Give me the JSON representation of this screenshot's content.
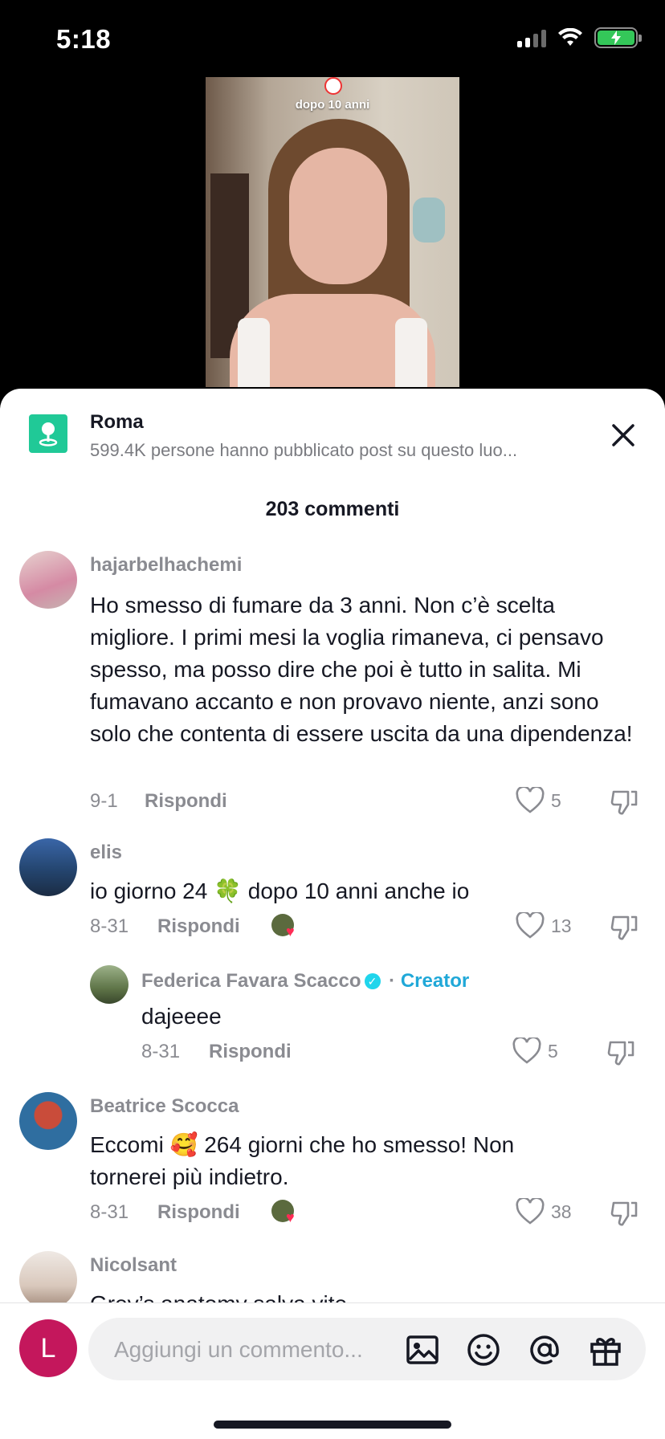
{
  "status_bar": {
    "time": "5:18"
  },
  "video": {
    "caption": "dopo 10 anni"
  },
  "location": {
    "title": "Roma",
    "subtitle": "599.4K persone hanno pubblicato post su questo luo..."
  },
  "comments_header": "203 commenti",
  "comments": [
    {
      "username": "hajarbelhachemi",
      "text": "Ho smesso di fumare da 3 anni. Non c’è scelta migliore. I primi mesi la voglia rimaneva, ci pensavo spesso, ma posso dire che poi è tutto in salita. Mi fumavano accanto e non provavo niente, anzi sono solo che contenta di essere uscita da una dipendenza!",
      "date": "9-1",
      "reply_label": "Rispondi",
      "likes": "5"
    },
    {
      "username": "elis",
      "text": "io giorno 24 🍀 dopo 10 anni anche io",
      "date": "8-31",
      "reply_label": "Rispondi",
      "likes": "13"
    },
    {
      "username": "Federica Favara Scacco",
      "creator_label": "Creator",
      "text": "dajeeee",
      "date": "8-31",
      "reply_label": "Rispondi",
      "likes": "5"
    },
    {
      "username": "Beatrice Scocca",
      "text": "Eccomi 🥰 264 giorni che ho smesso! Non tornerei più indietro.",
      "date": "8-31",
      "reply_label": "Rispondi",
      "likes": "38"
    },
    {
      "username": "Nicolsant",
      "text": "Grey’s anatomy salva vite"
    }
  ],
  "input": {
    "avatar_letter": "L",
    "placeholder": "Aggiungi un commento..."
  },
  "colors": {
    "accent_creator": "#20a8d8",
    "avatar_me": "#c4175c",
    "location_icon": "#20c997"
  }
}
